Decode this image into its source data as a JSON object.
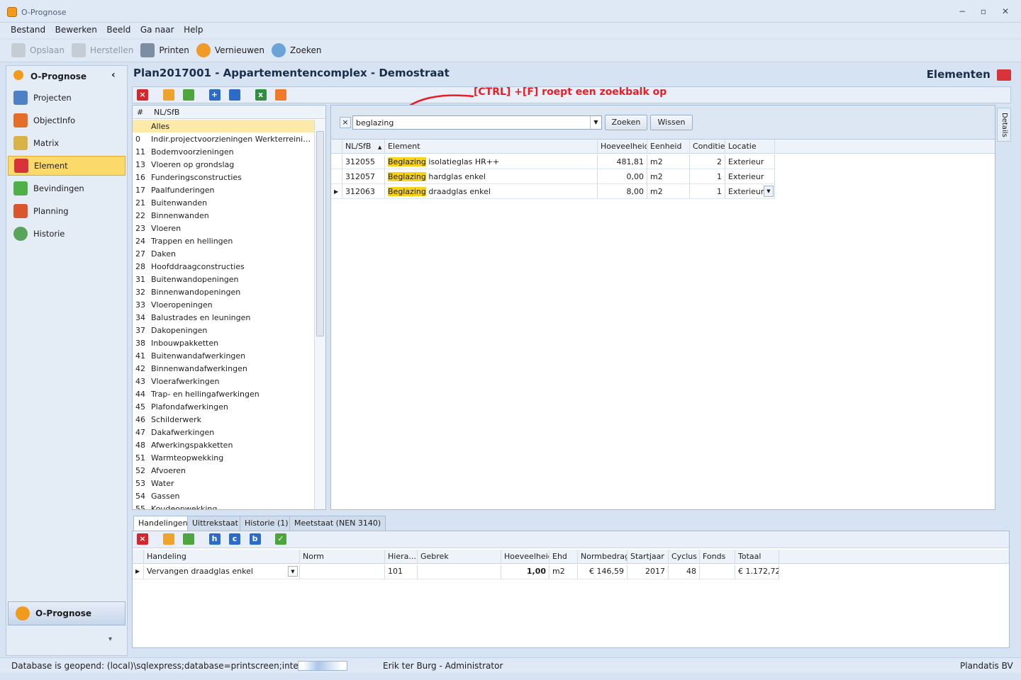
{
  "window": {
    "title": "O-Prognose",
    "min": "−",
    "max": "▫",
    "close": "✕"
  },
  "menu": [
    "Bestand",
    "Bewerken",
    "Beeld",
    "Ga naar",
    "Help"
  ],
  "toolbar": {
    "save": "Opslaan",
    "restore": "Herstellen",
    "print": "Printen",
    "refresh": "Vernieuwen",
    "search": "Zoeken"
  },
  "nav": {
    "header": "O-Prognose",
    "collapse": "‹",
    "items": [
      "Projecten",
      "ObjectInfo",
      "Matrix",
      "Element",
      "Bevindingen",
      "Planning",
      "Historie"
    ],
    "selected": "Element",
    "bottom": "O-Prognose",
    "more": "▾"
  },
  "page": {
    "title": "Plan2017001 - Appartementencomplex - Demostraat",
    "section": "Elementen"
  },
  "annotation": "[CTRL] +[F] roept een zoekbalk op",
  "tree": {
    "headers": [
      "#",
      "NL/SfB"
    ],
    "rows": [
      {
        "code": "",
        "name": "Alles"
      },
      {
        "code": "0",
        "name": "Indir.projectvoorzieningen Werkterreininrichting"
      },
      {
        "code": "11",
        "name": "Bodemvoorzieningen"
      },
      {
        "code": "13",
        "name": "Vloeren op grondslag"
      },
      {
        "code": "16",
        "name": "Funderingsconstructies"
      },
      {
        "code": "17",
        "name": "Paalfunderingen"
      },
      {
        "code": "21",
        "name": "Buitenwanden"
      },
      {
        "code": "22",
        "name": "Binnenwanden"
      },
      {
        "code": "23",
        "name": "Vloeren"
      },
      {
        "code": "24",
        "name": "Trappen en hellingen"
      },
      {
        "code": "27",
        "name": "Daken"
      },
      {
        "code": "28",
        "name": "Hoofddraagconstructies"
      },
      {
        "code": "31",
        "name": "Buitenwandopeningen"
      },
      {
        "code": "32",
        "name": "Binnenwandopeningen"
      },
      {
        "code": "33",
        "name": "Vloeropeningen"
      },
      {
        "code": "34",
        "name": "Balustrades en leuningen"
      },
      {
        "code": "37",
        "name": "Dakopeningen"
      },
      {
        "code": "38",
        "name": "Inbouwpakketten"
      },
      {
        "code": "41",
        "name": "Buitenwandafwerkingen"
      },
      {
        "code": "42",
        "name": "Binnenwandafwerkingen"
      },
      {
        "code": "43",
        "name": "Vloerafwerkingen"
      },
      {
        "code": "44",
        "name": "Trap- en hellingafwerkingen"
      },
      {
        "code": "45",
        "name": "Plafondafwerkingen"
      },
      {
        "code": "46",
        "name": "Schilderwerk"
      },
      {
        "code": "47",
        "name": "Dakafwerkingen"
      },
      {
        "code": "48",
        "name": "Afwerkingspakketten"
      },
      {
        "code": "51",
        "name": "Warmteopwekking"
      },
      {
        "code": "52",
        "name": "Afvoeren"
      },
      {
        "code": "53",
        "name": "Water"
      },
      {
        "code": "54",
        "name": "Gassen"
      },
      {
        "code": "55",
        "name": "Koudeopwekking"
      }
    ]
  },
  "search": {
    "value": "beglazing",
    "find_btn": "Zoeken",
    "clear_btn": "Wissen",
    "close": "×"
  },
  "grid": {
    "headers": [
      "NL/SfB",
      "Element",
      "Hoeveelheid",
      "Eenheid",
      "Conditie",
      "Locatie"
    ],
    "rows": [
      {
        "nlsfb": "312055",
        "hit": "Beglazing",
        "rest": " isolatieglas HR++",
        "qty": "481,81",
        "unit": "m2",
        "cond": "2",
        "loc": "Exterieur"
      },
      {
        "nlsfb": "312057",
        "hit": "Beglazing",
        "rest": " hardglas enkel",
        "qty": "0,00",
        "unit": "m2",
        "cond": "1",
        "loc": "Exterieur"
      },
      {
        "nlsfb": "312063",
        "hit": "Beglazing",
        "rest": " draadglas enkel",
        "qty": "8,00",
        "unit": "m2",
        "cond": "1",
        "loc": "Exterieur"
      }
    ]
  },
  "details_tab": "Details",
  "tabs": [
    "Handelingen",
    "Uittrekstaat",
    "Historie (1)",
    "Meetstaat (NEN 3140)"
  ],
  "bottom_toolbar": [
    "h",
    "c",
    "b"
  ],
  "bottom_grid": {
    "headers": [
      "Handeling",
      "Norm",
      "Hiera...",
      "Gebrek",
      "Hoeveelheid",
      "Ehd",
      "Normbedrag",
      "Startjaar",
      "Cyclus",
      "Fonds",
      "Totaal"
    ],
    "row": {
      "handeling": "Vervangen draadglas enkel",
      "norm": "",
      "hiera": "101",
      "gebrek": "",
      "qty": "1,00",
      "ehd": "m2",
      "normbedrag": "€ 146,59",
      "start": "2017",
      "cyclus": "48",
      "fonds": "",
      "totaal": "€ 1.172,72"
    }
  },
  "status": {
    "db": "Database is geopend: (local)\\sqlexpress;database=printscreen;integrated",
    "user": "Erik ter Burg - Administrator",
    "company": "Plandatis BV"
  },
  "colors": {
    "accent": "#fbd96a",
    "highlight": "#f7d217",
    "annotation": "#ea1c24"
  }
}
